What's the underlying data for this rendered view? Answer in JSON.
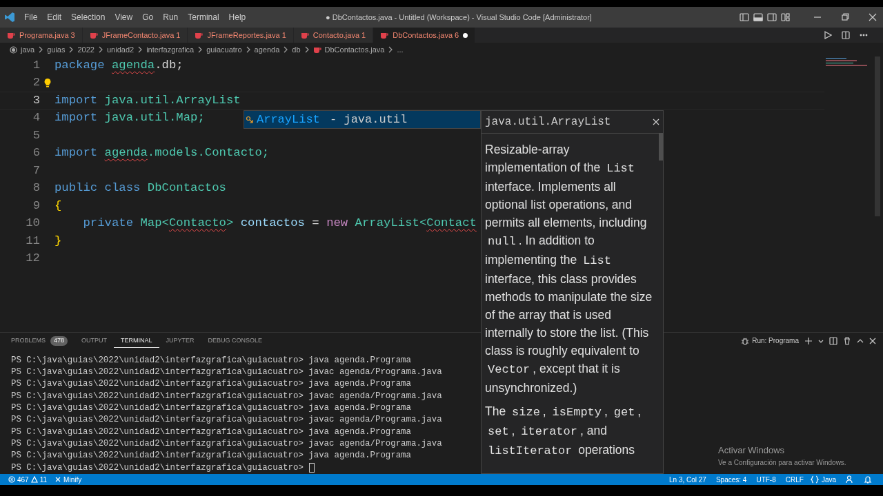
{
  "window": {
    "title": "● DbContactos.java - Untitled (Workspace) - Visual Studio Code [Administrator]"
  },
  "menu": [
    "File",
    "Edit",
    "Selection",
    "View",
    "Go",
    "Run",
    "Terminal",
    "Help"
  ],
  "tabs": [
    {
      "label": "Programa.java",
      "problems": "3",
      "selected": false,
      "dirty": false
    },
    {
      "label": "JFrameContacto.java",
      "problems": "1",
      "selected": false,
      "dirty": false
    },
    {
      "label": "JFrameReportes.java",
      "problems": "1",
      "selected": false,
      "dirty": false
    },
    {
      "label": "Contacto.java",
      "problems": "1",
      "selected": false,
      "dirty": false
    },
    {
      "label": "DbContactos.java",
      "problems": "6",
      "selected": true,
      "dirty": true
    }
  ],
  "breadcrumbs": [
    "java",
    "guias",
    "2022",
    "unidad2",
    "interfazgrafica",
    "guiacuatro",
    "agenda",
    "db",
    "DbContactos.java",
    "..."
  ],
  "editor": {
    "lines": [
      {
        "number": "1",
        "selected": false,
        "lightbulb": false,
        "tokens": [
          {
            "text": "package ",
            "kind": "keyword",
            "error": false
          },
          {
            "text": "agenda",
            "kind": "type",
            "error": true
          },
          {
            "text": ".db;",
            "kind": "plain",
            "error": false
          }
        ]
      },
      {
        "number": "2",
        "selected": false,
        "lightbulb": true
      },
      {
        "number": "3",
        "selected": true,
        "lightbulb": false,
        "tokens": [
          {
            "text": "import",
            "kind": "keyword",
            "error": false
          },
          {
            "text": " java.util.ArrayList",
            "kind": "type",
            "error": false
          }
        ]
      },
      {
        "number": "4",
        "selected": false,
        "lightbulb": false,
        "tokens": [
          {
            "text": "import",
            "kind": "keyword",
            "error": false
          },
          {
            "text": " java.util.Map;",
            "kind": "type",
            "error": false
          }
        ]
      },
      {
        "number": "5",
        "selected": false,
        "lightbulb": false
      },
      {
        "number": "6",
        "selected": false,
        "lightbulb": false,
        "tokens": [
          {
            "text": "import ",
            "kind": "keyword",
            "error": false
          },
          {
            "text": "agenda",
            "kind": "type",
            "error": true
          },
          {
            "text": ".models.Contacto;",
            "kind": "type",
            "error": false
          }
        ]
      },
      {
        "number": "7",
        "selected": false,
        "lightbulb": false
      },
      {
        "number": "8",
        "selected": false,
        "lightbulb": false,
        "tokens": [
          {
            "text": "public class",
            "kind": "keyword",
            "error": false
          },
          {
            "text": " DbContactos",
            "kind": "type",
            "error": false
          }
        ]
      },
      {
        "number": "9",
        "selected": false,
        "lightbulb": false,
        "tokens": [
          {
            "text": "{",
            "kind": "bracket",
            "error": false
          }
        ]
      },
      {
        "number": "10",
        "selected": false,
        "lightbulb": false,
        "tokens": [
          {
            "text": "    private",
            "kind": "keyword",
            "error": false
          },
          {
            "text": " Map<",
            "kind": "type",
            "error": false
          },
          {
            "text": "Contacto",
            "kind": "type",
            "error": true
          },
          {
            "text": ">",
            "kind": "type",
            "error": false
          },
          {
            "text": " contactos",
            "kind": "variable",
            "error": false
          },
          {
            "text": " = ",
            "kind": "plain",
            "error": false
          },
          {
            "text": "new",
            "kind": "control",
            "error": false
          },
          {
            "text": " ArrayList<",
            "kind": "type",
            "error": false
          },
          {
            "text": "Contact",
            "kind": "type",
            "error": true
          }
        ]
      },
      {
        "number": "11",
        "selected": false,
        "lightbulb": false,
        "tokens": [
          {
            "text": "}",
            "kind": "bracket",
            "error": false
          }
        ]
      },
      {
        "number": "12",
        "selected": false,
        "lightbulb": false
      }
    ]
  },
  "suggest": {
    "items": [
      {
        "label": "ArrayList",
        "detail": "- java.util",
        "selected": true
      }
    ]
  },
  "doc": {
    "title": "java.util.ArrayList",
    "paragraphs": [
      [
        {
          "text": "Resizable-array implementation of the ",
          "code": false
        },
        {
          "text": "List",
          "code": true
        },
        {
          "text": " interface. Implements all optional list operations, and permits all elements, including ",
          "code": false
        },
        {
          "text": "null",
          "code": true
        },
        {
          "text": ". In addition to implementing the ",
          "code": false
        },
        {
          "text": "List",
          "code": true
        },
        {
          "text": " interface, this class provides methods to manipulate the size of the array that is used internally to store the list. (This class is roughly equivalent to ",
          "code": false
        },
        {
          "text": "Vector",
          "code": true
        },
        {
          "text": ", except that it is unsynchronized.)",
          "code": false
        }
      ],
      [
        {
          "text": "The ",
          "code": false
        },
        {
          "text": "size",
          "code": true
        },
        {
          "text": ", ",
          "code": false
        },
        {
          "text": "isEmpty",
          "code": true
        },
        {
          "text": ", ",
          "code": false
        },
        {
          "text": "get",
          "code": true
        },
        {
          "text": ", ",
          "code": false
        },
        {
          "text": "set",
          "code": true
        },
        {
          "text": ", ",
          "code": false
        },
        {
          "text": "iterator",
          "code": true
        },
        {
          "text": ", and ",
          "code": false
        },
        {
          "text": "listIterator",
          "code": true
        },
        {
          "text": " operations",
          "code": false
        }
      ]
    ]
  },
  "panel": {
    "tabs": [
      {
        "label": "PROBLEMS",
        "badge": "478",
        "selected": false
      },
      {
        "label": "OUTPUT",
        "selected": false
      },
      {
        "label": "TERMINAL",
        "selected": true
      },
      {
        "label": "JUPYTER",
        "selected": false
      },
      {
        "label": "DEBUG CONSOLE",
        "selected": false
      }
    ],
    "run_config": "Run: Programa",
    "terminal": [
      {
        "prompt": "PS C:\\java\\guias\\2022\\unidad2\\interfazgrafica\\guiacuatro>",
        "command": "java agenda.Programa",
        "cursor": false
      },
      {
        "prompt": "PS C:\\java\\guias\\2022\\unidad2\\interfazgrafica\\guiacuatro>",
        "command": "javac agenda/Programa.java",
        "cursor": false
      },
      {
        "prompt": "PS C:\\java\\guias\\2022\\unidad2\\interfazgrafica\\guiacuatro>",
        "command": "java agenda.Programa",
        "cursor": false
      },
      {
        "prompt": "PS C:\\java\\guias\\2022\\unidad2\\interfazgrafica\\guiacuatro>",
        "command": "javac agenda/Programa.java",
        "cursor": false
      },
      {
        "prompt": "PS C:\\java\\guias\\2022\\unidad2\\interfazgrafica\\guiacuatro>",
        "command": "java agenda.Programa",
        "cursor": false
      },
      {
        "prompt": "PS C:\\java\\guias\\2022\\unidad2\\interfazgrafica\\guiacuatro>",
        "command": "javac agenda/Programa.java",
        "cursor": false
      },
      {
        "prompt": "PS C:\\java\\guias\\2022\\unidad2\\interfazgrafica\\guiacuatro>",
        "command": "java agenda.Programa",
        "cursor": false
      },
      {
        "prompt": "PS C:\\java\\guias\\2022\\unidad2\\interfazgrafica\\guiacuatro>",
        "command": "javac agenda/Programa.java",
        "cursor": false
      },
      {
        "prompt": "PS C:\\java\\guias\\2022\\unidad2\\interfazgrafica\\guiacuatro>",
        "command": "java agenda.Programa",
        "cursor": false
      },
      {
        "prompt": "PS C:\\java\\guias\\2022\\unidad2\\interfazgrafica\\guiacuatro>",
        "cursor": true
      }
    ]
  },
  "activation": {
    "title": "Activar Windows",
    "subtitle": "Ve a Configuración para activar Windows."
  },
  "status_bar": {
    "errors": "467",
    "warnings": "11",
    "minify": "Minify",
    "position": "Ln 3, Col 27",
    "spaces": "Spaces: 4",
    "encoding": "UTF-8",
    "eol": "CRLF",
    "language": "Java"
  }
}
